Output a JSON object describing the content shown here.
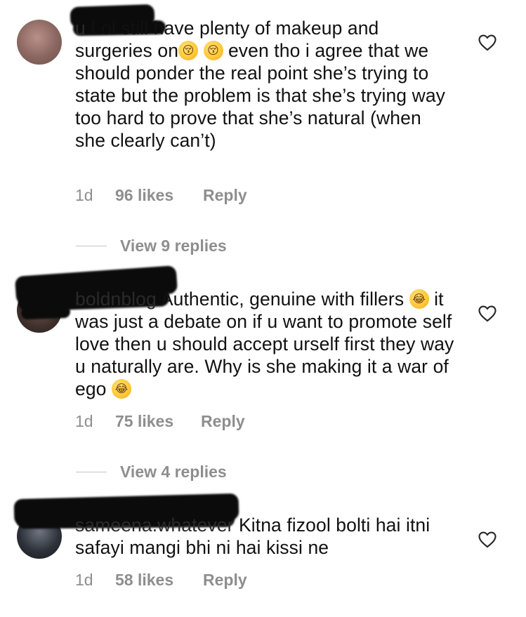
{
  "comments": [
    {
      "username": "u",
      "text_before_emoji": " Lol still have plenty of makeup and surgeries on",
      "emoji_a": "kissing-closed-eyes-face",
      "emoji_b": "kissing-closed-eyes-face",
      "text_after_emoji": " even tho i agree that we should ponder the real point she’s trying to state but the problem is that she’s trying way too hard to prove that she’s natural (when she clearly can’t)",
      "age": "1d",
      "likes": "96 likes",
      "reply": "Reply",
      "view_replies": "View 9 replies"
    },
    {
      "username": "boldnblog",
      "text_before_emoji": " Authentic, genuine with fillers ",
      "emoji_a": "face-with-tears-of-joy",
      "text_middle": " it was just a debate on if u want to promote self love then u should accept urself first they way u naturally are. Why is she making it a war of ego ",
      "emoji_b": "face-with-tears-of-joy",
      "age": "1d",
      "likes": "75 likes",
      "reply": "Reply",
      "view_replies": "View 4 replies"
    },
    {
      "username": "sameena.whatever",
      "text": " Kitna fizool bolti hai itni safayi mangi bhi ni hai kissi ne",
      "age": "1d",
      "likes": "58 likes",
      "reply": "Reply"
    }
  ],
  "emoji_glyphs": {
    "kissing": "😚",
    "tears_of_joy": "😂"
  },
  "colors": {
    "text": "#111111",
    "meta": "#8e8e8e",
    "redaction": "#0b0b0b"
  },
  "icons": [
    "heart-outline-icon"
  ]
}
